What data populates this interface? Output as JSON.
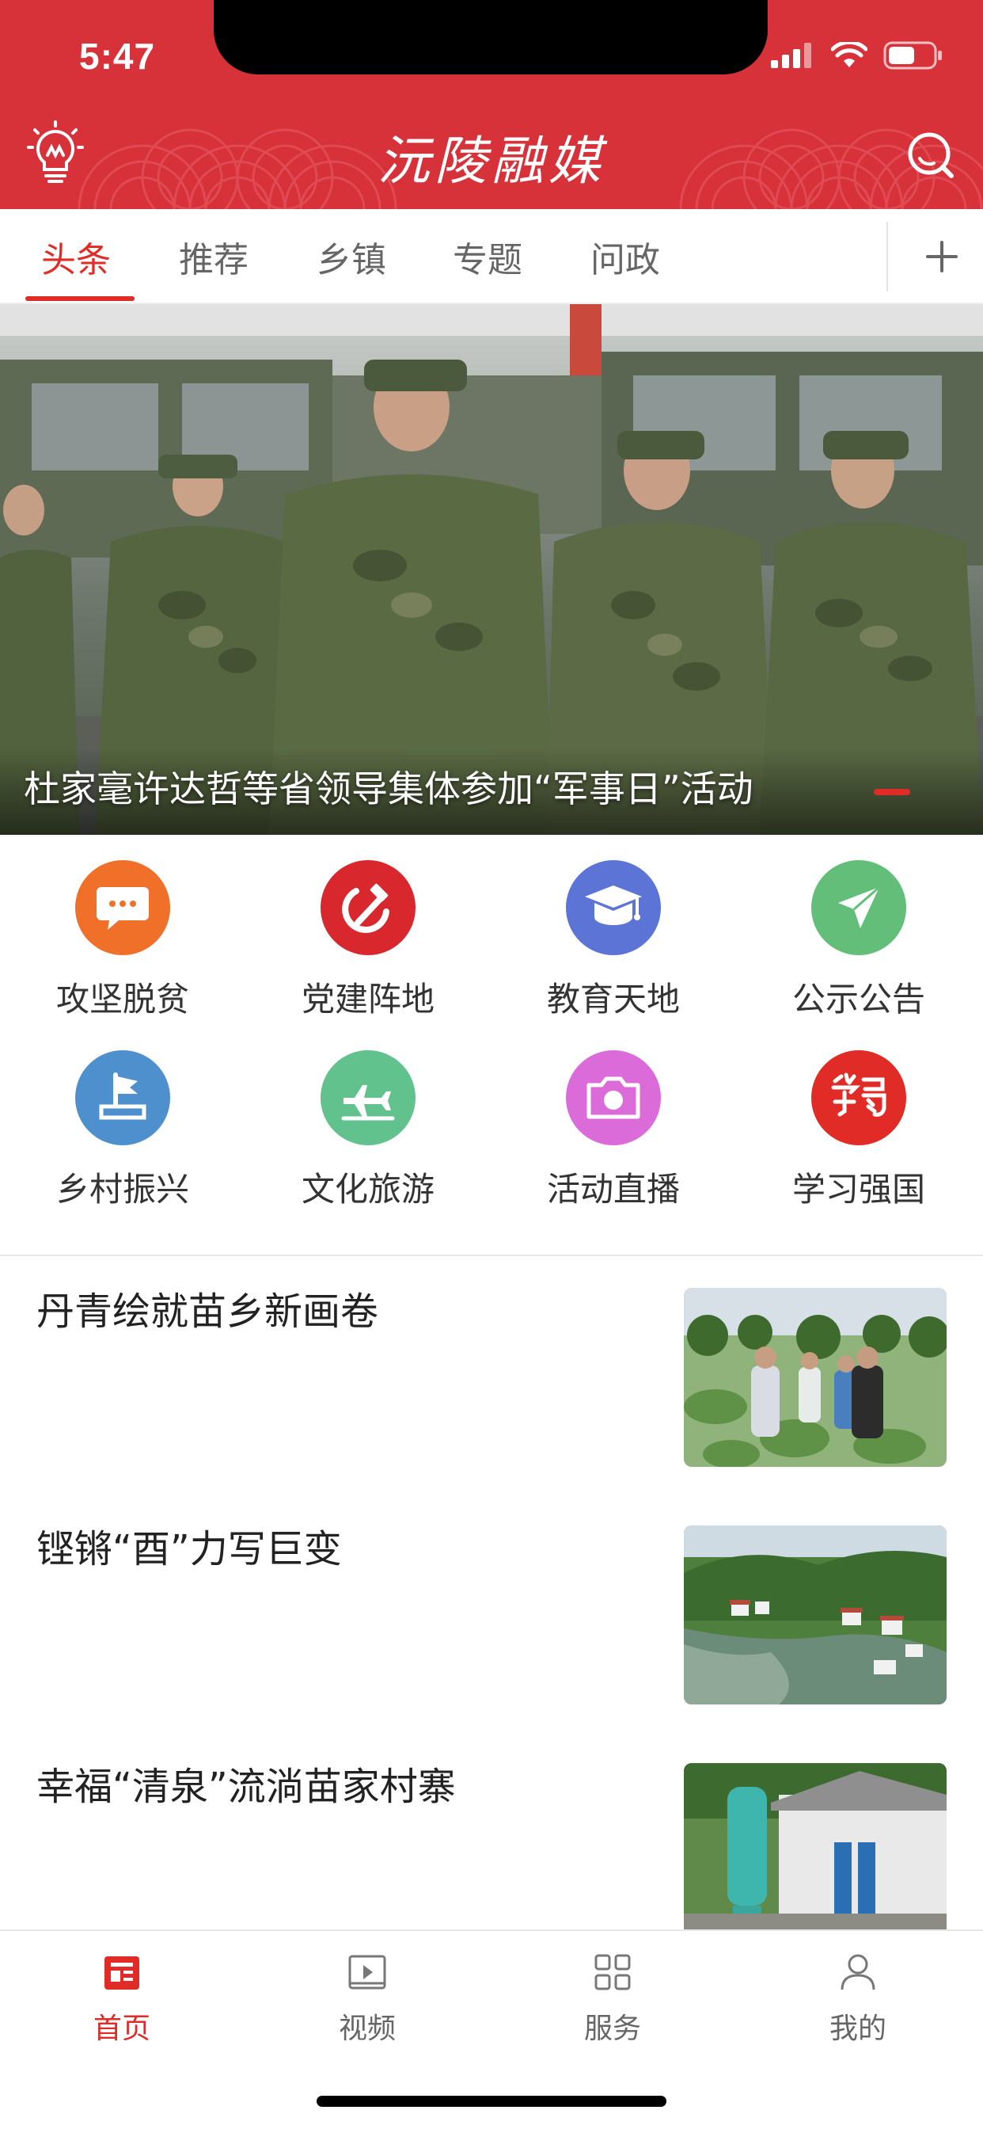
{
  "status_bar": {
    "time": "5:47"
  },
  "app": {
    "title": "沅陵融媒",
    "accent": "#d7313a"
  },
  "header": {
    "left_icon": "lightbulb-icon",
    "right_icon": "search-icon"
  },
  "tabs": {
    "items": [
      {
        "label": "头条",
        "active": true
      },
      {
        "label": "推荐"
      },
      {
        "label": "乡镇"
      },
      {
        "label": "专题"
      },
      {
        "label": "问政"
      }
    ],
    "more_icon": "plus-icon"
  },
  "banner": {
    "title": "杜家毫许达哲等省领导集体参加“军事日”活动"
  },
  "grid": {
    "items": [
      {
        "label": "攻坚脱贫",
        "icon": "chat-bubble-icon",
        "color": "#f0702a"
      },
      {
        "label": "党建阵地",
        "icon": "hammer-sickle-icon",
        "color": "#d8272d"
      },
      {
        "label": "教育天地",
        "icon": "graduation-cap-icon",
        "color": "#5b74d6"
      },
      {
        "label": "公示公告",
        "icon": "paper-plane-icon",
        "color": "#62be78"
      },
      {
        "label": "乡村振兴",
        "icon": "flag-icon",
        "color": "#4e8fce"
      },
      {
        "label": "文化旅游",
        "icon": "airplane-icon",
        "color": "#62c28e"
      },
      {
        "label": "活动直播",
        "icon": "camera-icon",
        "color": "#da6bd8"
      },
      {
        "label": "学习强国",
        "icon": "xuexi-logo-icon",
        "color": "#e02b26"
      }
    ]
  },
  "news": [
    {
      "title": "丹青绘就苗乡新画卷"
    },
    {
      "title": "铿锵“酉”力写巨变"
    },
    {
      "title": "幸福“清泉”流淌苗家村寨"
    }
  ],
  "bottom_nav": {
    "items": [
      {
        "label": "首页",
        "icon": "home-news-icon",
        "active": true
      },
      {
        "label": "视频",
        "icon": "video-icon"
      },
      {
        "label": "服务",
        "icon": "grid-services-icon"
      },
      {
        "label": "我的",
        "icon": "user-icon"
      }
    ]
  }
}
